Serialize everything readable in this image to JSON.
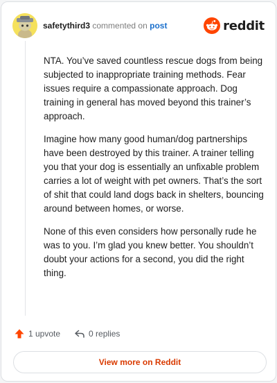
{
  "header": {
    "username": "safetythird3",
    "action_text": "commented on",
    "post_link": "post",
    "brand_name": "reddit"
  },
  "comment": {
    "paragraphs": [
      "NTA. You’ve saved countless rescue dogs from being subjected to inappropriate training methods. Fear issues require a compassionate approach. Dog training in general has moved beyond this trainer’s approach.",
      "Imagine how many good human/dog partnerships have been destroyed by this trainer. A trainer telling you that your dog is essentially an unfixable problem carries a lot of weight with pet owners. That’s the sort of shit that could land dogs back in shelters, bouncing around between homes, or worse.",
      "None of this even considers how personally rude he was to you. I’m glad you knew better. You shouldn’t doubt your actions for a second, you did the right thing."
    ]
  },
  "actions": {
    "upvote_label": "1 upvote",
    "replies_label": "0 replies"
  },
  "footer": {
    "view_more_label": "View more on Reddit"
  },
  "colors": {
    "brand_orange": "#ff4500",
    "link_blue": "#1a6fcc",
    "cta_text": "#d93a00",
    "avatar_bg": "#f5e15c"
  },
  "icons": {
    "avatar": "snoo-avatar-icon",
    "brand": "reddit-logo-icon",
    "upvote": "upvote-arrow-icon",
    "reply": "reply-arrow-icon"
  }
}
